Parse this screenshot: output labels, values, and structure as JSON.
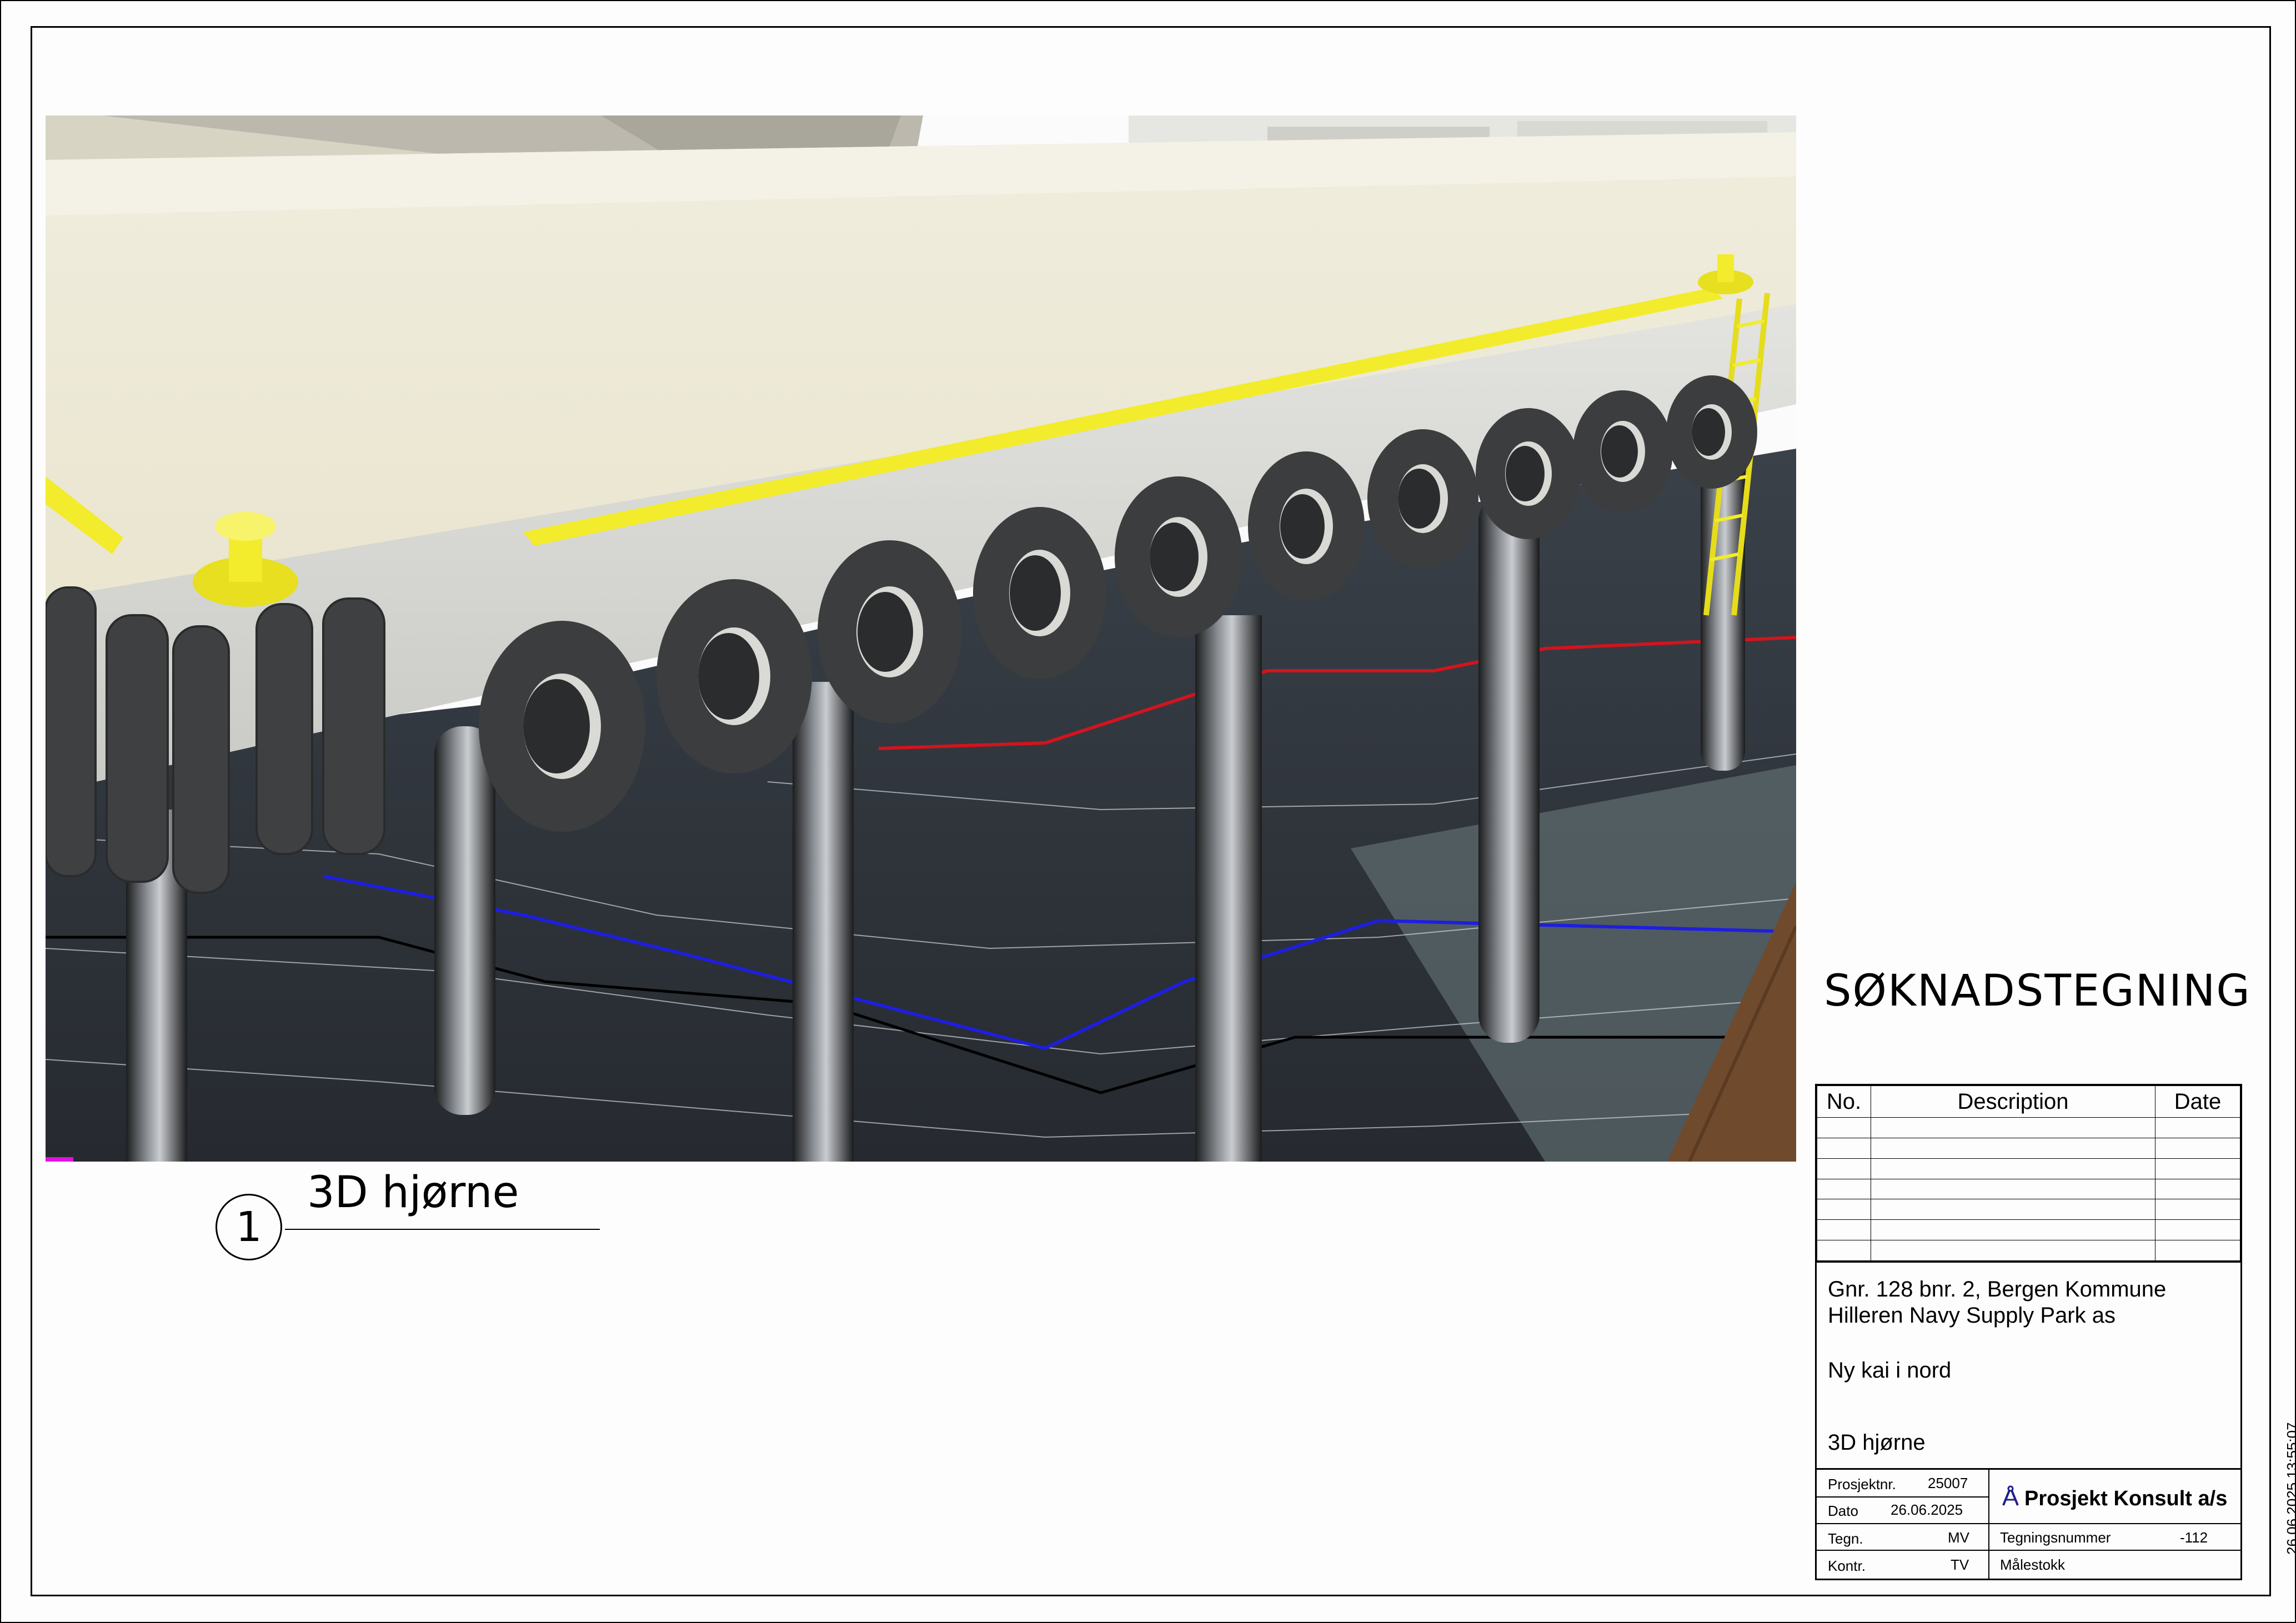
{
  "status_text": "SØKNADSTEGNING",
  "view": {
    "number": "1",
    "title": "3D hjørne"
  },
  "revision_table": {
    "headers": {
      "no": "No.",
      "description": "Description",
      "date": "Date"
    },
    "rows": [
      {
        "no": "",
        "description": "",
        "date": ""
      },
      {
        "no": "",
        "description": "",
        "date": ""
      },
      {
        "no": "",
        "description": "",
        "date": ""
      },
      {
        "no": "",
        "description": "",
        "date": ""
      },
      {
        "no": "",
        "description": "",
        "date": ""
      },
      {
        "no": "",
        "description": "",
        "date": ""
      },
      {
        "no": "",
        "description": "",
        "date": ""
      }
    ]
  },
  "project_info": {
    "property": "Gnr. 128 bnr. 2, Bergen Kommune",
    "client": "Hilleren Navy Supply Park as",
    "project": "Ny kai i nord",
    "drawing_title": "3D hjørne"
  },
  "meta": {
    "prosjektnr_label": "Prosjektnr.",
    "prosjektnr": "25007",
    "dato_label": "Dato",
    "dato": "26.06.2025",
    "tegn_label": "Tegn.",
    "tegn": "MV",
    "kontr_label": "Kontr.",
    "kontr": "TV",
    "tegningsnummer_label": "Tegningsnummer",
    "tegningsnummer": "-112",
    "malestokk_label": "Målestokk",
    "company": "Prosjekt Konsult a/s"
  },
  "timestamp": "26.06.2025 13:55:07",
  "colors": {
    "deck": "#ede9d6",
    "fender": "#3c3d3e",
    "safety_yellow": "#f2ec2c",
    "water": "#2f353d",
    "contour_red": "#d2141e",
    "contour_blue": "#1e1ee0"
  },
  "icons": {
    "logo": "compass-icon"
  }
}
